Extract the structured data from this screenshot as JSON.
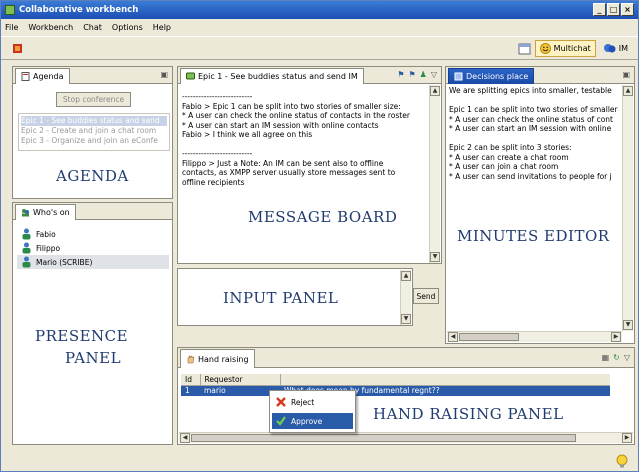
{
  "window": {
    "title": "Collaborative workbench",
    "buttons": [
      "_",
      "□",
      "×"
    ]
  },
  "menu": [
    "File",
    "Workbench",
    "Chat",
    "Options",
    "Help"
  ],
  "toolbar": {
    "multichat_label": "Multichat",
    "im_label": "IM"
  },
  "agenda": {
    "tab_label": "Agenda",
    "stop_button": "Stop conference",
    "items": [
      "Epic 1 - See buddies status and send",
      "Epic 2 - Create and join a chat room",
      "Epic 3 - Organize and join an eConfe"
    ],
    "caption": "AGENDA"
  },
  "presence": {
    "tab_label": "Who's on",
    "contacts": [
      "Fabio",
      "Filippo",
      "Mario (SCRIBE)"
    ],
    "caption_line1": "PRESENCE",
    "caption_line2": "PANEL"
  },
  "message_board": {
    "tab_label": "Epic 1 - See buddies status and send IM",
    "lines": [
      "--------------------------",
      "Fabio > Epic 1 can be split into two stories of smaller size:",
      "* A user can check the online status of contacts in the roster",
      "* A user can start an IM session with online contacts",
      "Fabio > I think we all agree on this",
      "",
      "--------------------------",
      "Filippo > Just a Note: An IM can be sent also to offline",
      "contacts, as XMPP server usually store messages sent to",
      "offline recipients"
    ],
    "caption": "MESSAGE BOARD"
  },
  "input_panel": {
    "caption": "INPUT PANEL",
    "send_label": "Send"
  },
  "minutes": {
    "tab_label": "Decisions place",
    "lines": [
      "We are splitting epics into smaller, testable",
      "",
      "Epic 1 can be split into two stories of smaller",
      "* A user can check the online status of cont",
      "* A user can start an IM session with online",
      "",
      "Epic 2 can be split into 3 stories:",
      "* A user can create a chat room",
      "* A user can join a chat room",
      "* A user can send invitations to people for j"
    ],
    "caption": "MINUTES EDITOR"
  },
  "hand_raising": {
    "tab_label": "Hand raising",
    "columns": [
      "Id",
      "Requestor",
      ""
    ],
    "rows": [
      [
        "1",
        "mario",
        "What does mean by fundamental regnt??"
      ]
    ],
    "caption": "HAND RAISING PANEL",
    "context_menu": [
      "Reject",
      "Approve"
    ]
  },
  "colors": {
    "titlebar": "#1d4fb6",
    "caption": "#1f3b6f",
    "selection": "#2a5ba8"
  },
  "icons": [
    "app-icon",
    "flag-icon",
    "calendar-icon",
    "smiley-icon",
    "im-icon",
    "agenda-icon",
    "people-icon",
    "person-icon",
    "hand-icon",
    "reject-icon",
    "approve-icon",
    "lightbulb-icon"
  ]
}
